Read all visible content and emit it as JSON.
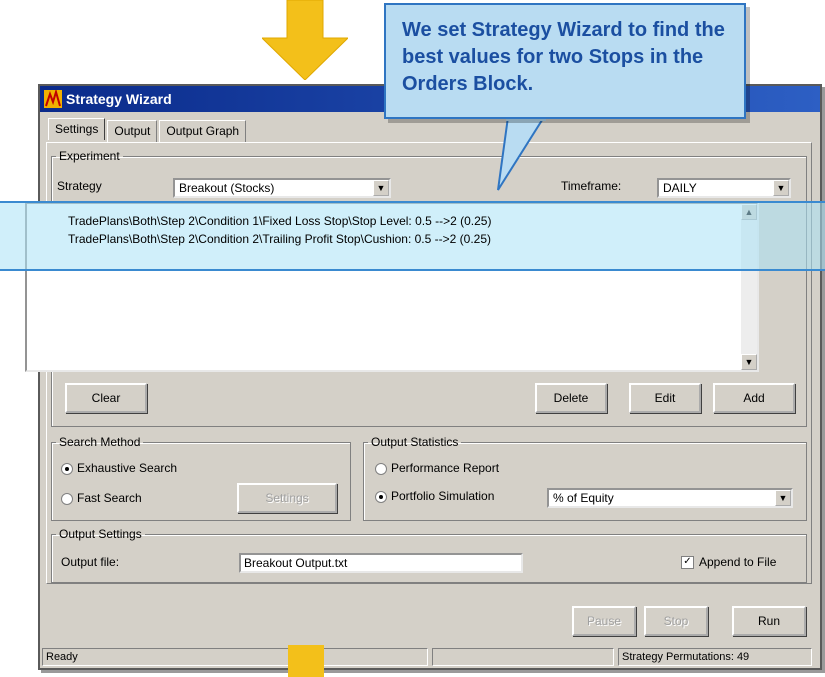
{
  "window": {
    "title": "Strategy Wizard"
  },
  "tabs": [
    "Settings",
    "Output",
    "Output Graph"
  ],
  "experiment": {
    "legend": "Experiment",
    "strategy_label": "Strategy",
    "strategy_value": "Breakout (Stocks)",
    "timeframe_label": "Timeframe:",
    "timeframe_value": "DAILY",
    "list_items": [
      "TradePlans\\Both\\Step 2\\Condition 1\\Fixed Loss Stop\\Stop Level: 0.5 -->2 (0.25)",
      "TradePlans\\Both\\Step 2\\Condition 2\\Trailing Profit Stop\\Cushion: 0.5 -->2 (0.25)"
    ],
    "clear_button": "Clear",
    "delete_button": "Delete",
    "edit_button": "Edit",
    "add_button": "Add"
  },
  "search_method": {
    "legend": "Search Method",
    "exhaustive_label": "Exhaustive Search",
    "fast_label": "Fast Search",
    "settings_button": "Settings",
    "selected": "Exhaustive Search"
  },
  "output_statistics": {
    "legend": "Output Statistics",
    "performance_label": "Performance Report",
    "portfolio_label": "Portfolio Simulation",
    "portfolio_option": "% of Equity",
    "selected": "Portfolio Simulation"
  },
  "output_settings": {
    "legend": "Output Settings",
    "file_label": "Output file:",
    "file_value": "Breakout Output.txt",
    "append_label": "Append to File",
    "append_checked": true
  },
  "footer_buttons": {
    "pause": "Pause",
    "stop": "Stop",
    "run": "Run"
  },
  "status": {
    "left": "Ready",
    "right": "Strategy Permutations: 49"
  },
  "callout": {
    "text": "We set Strategy Wizard to find the best values for two Stops in the Orders Block."
  },
  "colors": {
    "arrow": "#f3c01a",
    "callout_fill": "#b9dcf2",
    "callout_text": "#1b4fa1",
    "highlight_border": "#3a8ad0"
  }
}
